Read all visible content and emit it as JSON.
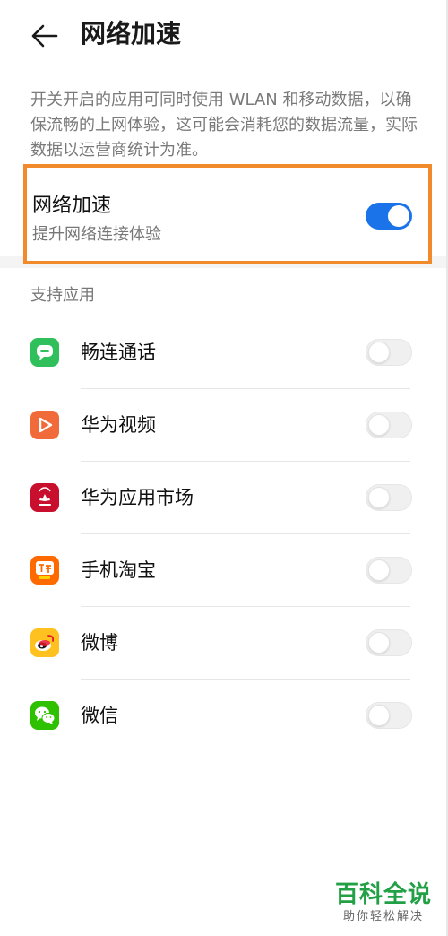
{
  "header": {
    "title": "网络加速",
    "back_icon": "arrow-left-icon"
  },
  "description": "开关开启的应用可同时使用 WLAN 和移动数据，以确保流畅的上网体验，这可能会消耗您的数据流量，实际数据以运营商统计为准。",
  "accelerator": {
    "title": "网络加速",
    "subtitle": "提升网络连接体验",
    "enabled": true
  },
  "section_label": "支持应用",
  "apps": [
    {
      "name": "畅连通话",
      "enabled": false,
      "icon": "chat-bubble-icon",
      "color": "#2fbf5b"
    },
    {
      "name": "华为视频",
      "enabled": false,
      "icon": "play-icon",
      "color": "#f06a3a"
    },
    {
      "name": "华为应用市场",
      "enabled": false,
      "icon": "huawei-icon",
      "color": "#c8102e"
    },
    {
      "name": "手机淘宝",
      "enabled": false,
      "icon": "taobao-icon",
      "color": "#ff6a00"
    },
    {
      "name": "微博",
      "enabled": false,
      "icon": "weibo-icon",
      "color": "#ffc11f"
    },
    {
      "name": "微信",
      "enabled": false,
      "icon": "wechat-icon",
      "color": "#2dc100"
    }
  ],
  "watermark": {
    "main": "百科全说",
    "sub": "助你轻松解决"
  },
  "colors": {
    "accent": "#1a73e8",
    "highlight_border": "#f08a2a"
  }
}
